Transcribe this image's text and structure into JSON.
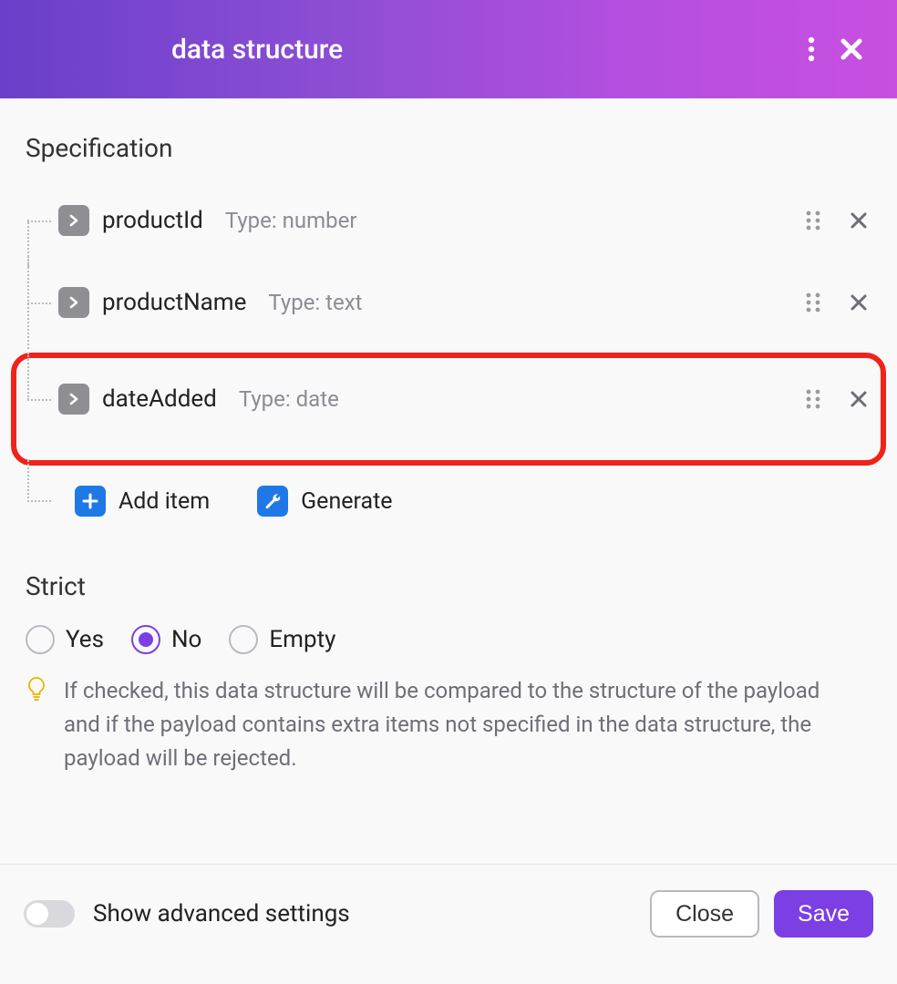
{
  "header": {
    "title": "data structure"
  },
  "specification": {
    "heading": "Specification",
    "items": [
      {
        "name": "productId",
        "type": "Type: number",
        "highlighted": false
      },
      {
        "name": "productName",
        "type": "Type: text",
        "highlighted": false
      },
      {
        "name": "dateAdded",
        "type": "Type: date",
        "highlighted": true
      }
    ],
    "add_label": "Add item",
    "generate_label": "Generate"
  },
  "strict": {
    "heading": "Strict",
    "options": [
      "Yes",
      "No",
      "Empty"
    ],
    "selected": "No",
    "hint": "If checked, this data structure will be compared to the structure of the payload and if the payload contains extra items not specified in the data structure, the payload will be rejected."
  },
  "footer": {
    "toggle_label": "Show advanced settings",
    "close_label": "Close",
    "save_label": "Save"
  }
}
